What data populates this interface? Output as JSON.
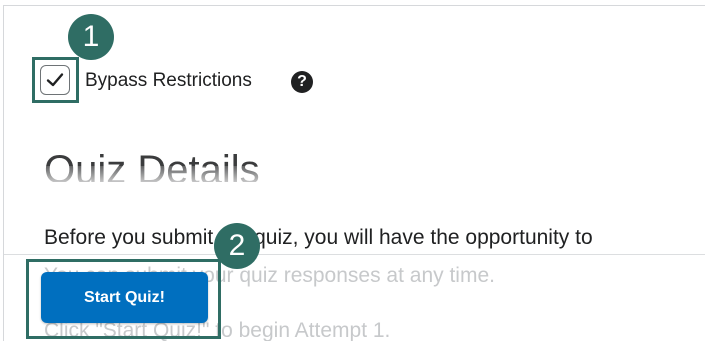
{
  "annotations": {
    "step1": "1",
    "step2": "2"
  },
  "bypass": {
    "label": "Bypass Restrictions",
    "checked": true,
    "help_icon": "?"
  },
  "quiz": {
    "heading": "Quiz Details",
    "instructions": "Before you submit the quiz, you will have the opportunity to",
    "ghost_line_1": "You can submit your quiz responses at any time.",
    "ghost_line_2": "Click \"Start Quiz!\" to begin Attempt 1."
  },
  "footer": {
    "start_button": "Start Quiz!"
  },
  "colors": {
    "accent": "#006fbf",
    "annotation": "#2f6d64"
  }
}
